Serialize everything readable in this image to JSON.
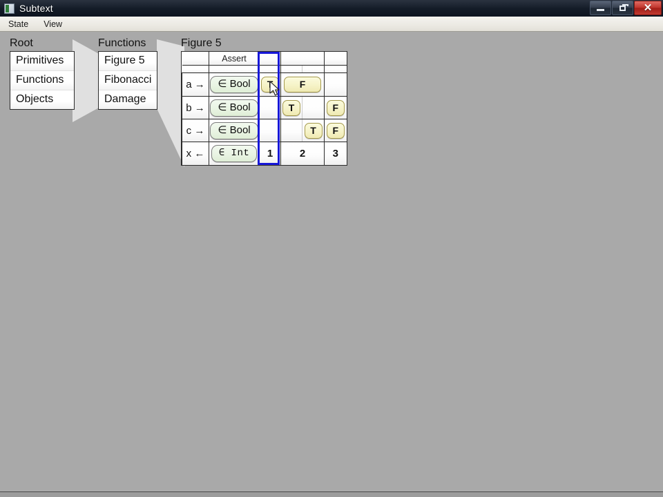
{
  "window": {
    "title": "Subtext",
    "icon": "app-icon",
    "buttons": [
      {
        "name": "minimize",
        "glyph": "minimize-icon"
      },
      {
        "name": "maximize",
        "glyph": "maximize-icon"
      },
      {
        "name": "close",
        "glyph": "close-icon",
        "label": "✕"
      }
    ]
  },
  "menubar": {
    "items": [
      {
        "label": "State"
      },
      {
        "label": "View"
      }
    ]
  },
  "panels": [
    {
      "title": "Root",
      "items": [
        {
          "label": "Primitives"
        },
        {
          "label": "Functions"
        },
        {
          "label": "Objects"
        }
      ]
    },
    {
      "title": "Functions",
      "items": [
        {
          "label": "Figure 5"
        },
        {
          "label": "Fibonacci"
        },
        {
          "label": "Damage"
        }
      ]
    }
  ],
  "figure": {
    "title": "Figure 5",
    "header": {
      "assert_label": "Assert"
    },
    "rows": [
      {
        "label": "a →",
        "type": "∈ Bool",
        "cells": [
          {
            "col": 1,
            "value": "T",
            "span": 1
          },
          {
            "col": 2,
            "value": "F",
            "span": 2
          }
        ]
      },
      {
        "label": "b →",
        "type": "∈ Bool",
        "cells": [
          {
            "col": 2,
            "value": "T",
            "span": 1
          },
          {
            "col": 4,
            "value": "F",
            "span": 1
          }
        ]
      },
      {
        "label": "c →",
        "type": "∈ Bool",
        "cells": [
          {
            "col": 3,
            "value": "T",
            "span": 1
          },
          {
            "col": 4,
            "value": "F",
            "span": 1
          }
        ]
      },
      {
        "label": "x ←",
        "type": "∈ Int",
        "cells": [
          {
            "col": 1,
            "value": "1",
            "span": 1
          },
          {
            "col": 2,
            "value": "2",
            "span": 2
          },
          {
            "col": 4,
            "value": "3",
            "span": 1
          }
        ]
      }
    ],
    "selected_column": 1,
    "selection_color": "#1717d8"
  },
  "colors": {
    "workspace_bg": "#a9a9a9",
    "panel_bg": "#ffffff",
    "type_pill": "#e9f4e3",
    "bool_pill": "#f6f3c8",
    "titlebar": "#141c28",
    "close_button": "#c0352c"
  }
}
